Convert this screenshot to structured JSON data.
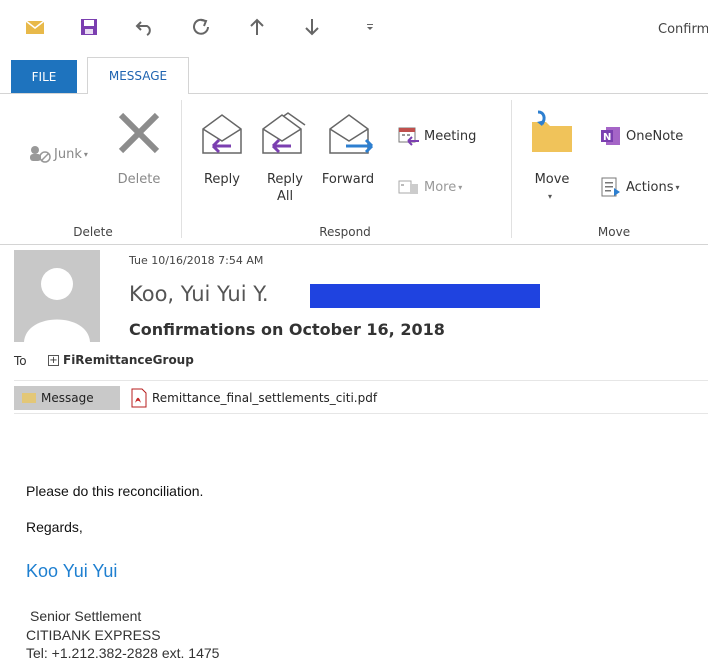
{
  "window": {
    "title_fragment": "Confirm"
  },
  "tabs": {
    "file": "FILE",
    "message": "MESSAGE"
  },
  "ribbon": {
    "delete_group": {
      "label": "Delete",
      "junk": "Junk",
      "delete": "Delete"
    },
    "respond_group": {
      "label": "Respond",
      "reply": "Reply",
      "reply_all": "Reply\nAll",
      "forward": "Forward",
      "meeting": "Meeting",
      "more": "More"
    },
    "move_group": {
      "label": "Move",
      "move": "Move",
      "onenote": "OneNote",
      "actions": "Actions"
    }
  },
  "header": {
    "date": "Tue 10/16/2018 7:54 AM",
    "from": "Koo, Yui Yui Y.",
    "subject": "Confirmations on October 16, 2018",
    "to_label": "To",
    "to_name": "FiRemittanceGroup"
  },
  "attachments": {
    "message_tab": "Message",
    "file": "Remittance_final_settlements_citi.pdf"
  },
  "body": {
    "line1": "Please do this reconciliation.",
    "regards": "Regards,",
    "sig_name": "Koo Yui Yui",
    "sig_title": "Senior Settlement",
    "sig_company": "CITIBANK EXPRESS",
    "sig_tel": "Tel: +1.212.382-2828 ext. 1475"
  },
  "colors": {
    "accent": "#1e73be",
    "link": "#1e7fd0",
    "reply_arrow": "#7b3fb0",
    "forward_arrow": "#2d7fd0"
  }
}
